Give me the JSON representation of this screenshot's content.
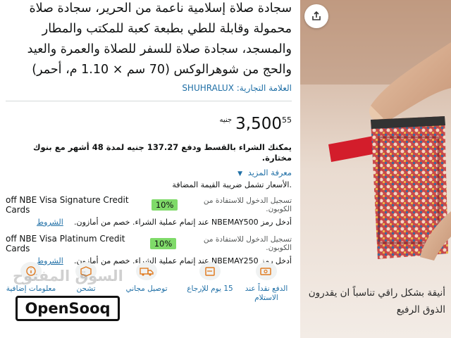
{
  "product": {
    "title": "سجادة صلاة إسلامية ناعمة من الحرير، سجادة صلاة محمولة وقابلة للطي بطبعة كعبة للمكتب والمطار والمسجد، سجادة صلاة للسفر للصلاة والعمرة والعيد والحج من شوهرالوكس (70 سم × 1.10 م، أحمر)",
    "brand_label": "العلامة التجارية:",
    "brand_value": "SHUHRALUX"
  },
  "price": {
    "currency": "جنيه",
    "whole": "3,500",
    "fraction": "55"
  },
  "installment_text": "يمكنك الشراء بالقسط ودفع 137.27 جنيه لمدة 48 أشهر مع بنوك مختارة.",
  "more_link": "معرفة المزيد",
  "vat_text": ".الأسعار تشمل ضريبة القيمة المضافة",
  "offers": [
    {
      "card_name": "off NBE Visa Signature Credit Cards",
      "percent": "10%",
      "coupon_note": "تسجيل الدخول للاستفادة من الكوبون.",
      "code_text": "أدخل رمز NBEMAY500 عند إتمام عملية الشراء. خصم من أمازون.",
      "terms": "الشروط"
    },
    {
      "card_name": "off NBE Visa Platinum Credit Cards",
      "percent": "10%",
      "coupon_note": "تسجيل الدخول للاستفادة من الكوبون.",
      "code_text": "أدخل رمز NBEMAY250 عند إتمام عملية الشراء. خصم من أمازون.",
      "terms": "الشروط"
    }
  ],
  "features": [
    {
      "icon": "cash-on-delivery-icon",
      "label": "الدفع نقداً عند الاستلام"
    },
    {
      "icon": "return-icon",
      "label": "15 يوم للإرجاع"
    },
    {
      "icon": "delivery-truck-icon",
      "label": "توصيل مجاني"
    },
    {
      "icon": "shipping-icon",
      "label": "تشحن"
    },
    {
      "icon": "info-icon",
      "label": "معلومات إضافية"
    }
  ],
  "watermark": {
    "arabic": "السوق المفتوح",
    "latin": "OpenSooq"
  },
  "gallery": {
    "caption": "أنيقة بشكل راقي تناسباً ان يقدرون الذوق الرفيع"
  },
  "colors": {
    "link": "#1f6fa6",
    "badge": "#7fda69",
    "strap": "#d31d2b"
  }
}
